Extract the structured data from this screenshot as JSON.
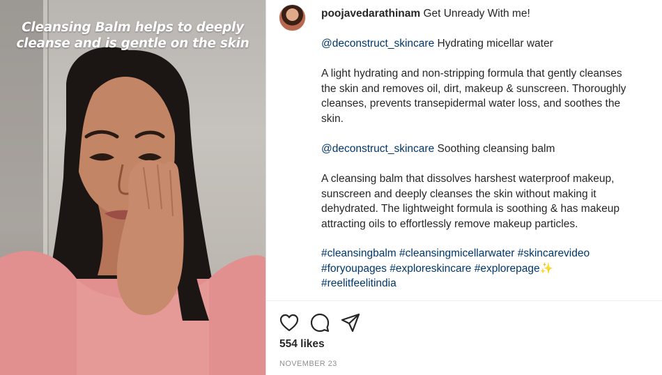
{
  "media": {
    "overlay_line1": "Cleansing Balm helps to deeply",
    "overlay_line2": "cleanse and is gentle on the skin"
  },
  "post": {
    "username": "poojavedarathinam",
    "title": "Get Unready With me!",
    "product1": {
      "mention": "@deconstruct_skincare",
      "name": "Hydrating micellar water",
      "description_lines": [
        "A light hydrating and non-stripping formula that gently cleanses",
        "the skin and removes oil, dirt, makeup & sunscreen. Thoroughly",
        "cleanses, prevents transepidermal water loss, and soothes the",
        "skin."
      ]
    },
    "product2": {
      "mention": "@deconstruct_skincare",
      "name": "Soothing cleansing balm",
      "description_lines": [
        "A cleansing balm that dissolves harshest waterproof makeup,",
        "sunscreen and deeply cleanses the skin without making it",
        "dehydrated. The lightweight formula is soothing & has makeup",
        "attracting oils to effortlessly remove makeup particles."
      ]
    },
    "hashtags": {
      "line1": "#cleansingbalm #cleansingmicellarwater #skincarevideo",
      "line2": "#foryoupages #exploreskincare #explorepage",
      "line2_emoji": "✨",
      "line3": "#reelitfeelitindia"
    },
    "likes": "554 likes",
    "date": "NOVEMBER 23"
  },
  "icons": {
    "like": "heart-icon",
    "comment": "comment-icon",
    "share": "send-icon"
  },
  "colors": {
    "link": "#00376b",
    "text": "#262626",
    "muted": "#8e8e8e"
  }
}
